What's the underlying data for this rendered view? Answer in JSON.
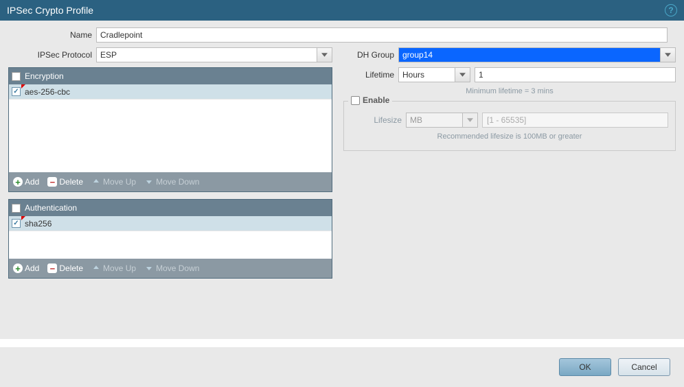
{
  "title": "IPSec Crypto Profile",
  "name": {
    "label": "Name",
    "value": "Cradlepoint"
  },
  "ipsec_protocol": {
    "label": "IPSec Protocol",
    "value": "ESP"
  },
  "dh_group": {
    "label": "DH Group",
    "value": "group14"
  },
  "lifetime": {
    "label": "Lifetime",
    "unit": "Hours",
    "value": "1",
    "hint": "Minimum lifetime = 3 mins"
  },
  "encryption": {
    "header": "Encryption",
    "items": [
      {
        "label": "aes-256-cbc",
        "checked": true
      }
    ],
    "toolbar": {
      "add": "Add",
      "delete": "Delete",
      "move_up": "Move Up",
      "move_down": "Move Down"
    }
  },
  "authentication": {
    "header": "Authentication",
    "items": [
      {
        "label": "sha256",
        "checked": true
      }
    ],
    "toolbar": {
      "add": "Add",
      "delete": "Delete",
      "move_up": "Move Up",
      "move_down": "Move Down"
    }
  },
  "enable": {
    "label": "Enable",
    "checked": false,
    "lifesize_label": "Lifesize",
    "lifesize_unit": "MB",
    "lifesize_placeholder": "[1 - 65535]",
    "hint": "Recommended lifesize is 100MB or greater"
  },
  "buttons": {
    "ok": "OK",
    "cancel": "Cancel"
  }
}
